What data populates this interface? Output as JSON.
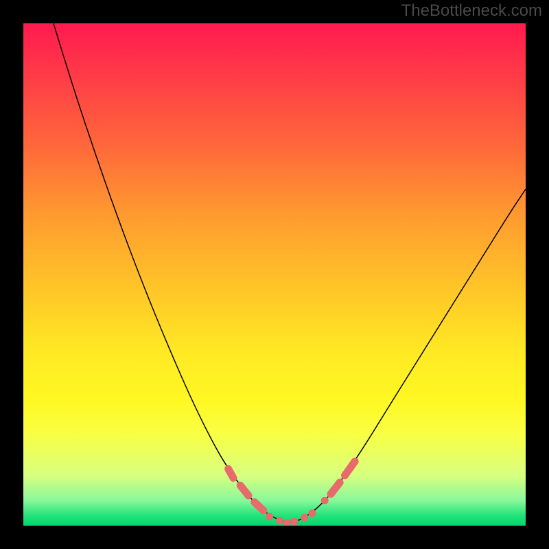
{
  "watermark": "TheBottleneck.com",
  "chart_data": {
    "type": "line",
    "title": "",
    "xlabel": "",
    "ylabel": "",
    "xlim": [
      0,
      1
    ],
    "ylim": [
      0,
      1
    ],
    "grid": false,
    "series": [
      {
        "name": "curve",
        "color": "#000000",
        "points": [
          {
            "x": 0.06,
            "y": 1.0
          },
          {
            "x": 0.1,
            "y": 0.87
          },
          {
            "x": 0.15,
            "y": 0.72
          },
          {
            "x": 0.2,
            "y": 0.58
          },
          {
            "x": 0.25,
            "y": 0.45
          },
          {
            "x": 0.3,
            "y": 0.33
          },
          {
            "x": 0.34,
            "y": 0.24
          },
          {
            "x": 0.38,
            "y": 0.16
          },
          {
            "x": 0.41,
            "y": 0.11
          },
          {
            "x": 0.44,
            "y": 0.07
          },
          {
            "x": 0.47,
            "y": 0.035
          },
          {
            "x": 0.5,
            "y": 0.015
          },
          {
            "x": 0.525,
            "y": 0.006
          },
          {
            "x": 0.55,
            "y": 0.01
          },
          {
            "x": 0.58,
            "y": 0.03
          },
          {
            "x": 0.61,
            "y": 0.06
          },
          {
            "x": 0.64,
            "y": 0.1
          },
          {
            "x": 0.68,
            "y": 0.16
          },
          {
            "x": 0.72,
            "y": 0.225
          },
          {
            "x": 0.77,
            "y": 0.305
          },
          {
            "x": 0.82,
            "y": 0.385
          },
          {
            "x": 0.87,
            "y": 0.465
          },
          {
            "x": 0.92,
            "y": 0.545
          },
          {
            "x": 0.97,
            "y": 0.625
          },
          {
            "x": 1.0,
            "y": 0.67
          }
        ]
      }
    ],
    "markers": {
      "color": "#e86a6a",
      "dot_radius": 5.5,
      "segments": [
        {
          "from": {
            "x": 0.408,
            "y": 0.113
          },
          "to": {
            "x": 0.418,
            "y": 0.095
          }
        },
        {
          "from": {
            "x": 0.432,
            "y": 0.08
          },
          "to": {
            "x": 0.448,
            "y": 0.06
          }
        },
        {
          "from": {
            "x": 0.46,
            "y": 0.047
          },
          "to": {
            "x": 0.478,
            "y": 0.03
          }
        },
        {
          "from": {
            "x": 0.612,
            "y": 0.063
          },
          "to": {
            "x": 0.63,
            "y": 0.086
          }
        },
        {
          "from": {
            "x": 0.64,
            "y": 0.1
          },
          "to": {
            "x": 0.66,
            "y": 0.128
          }
        }
      ],
      "dots": [
        {
          "x": 0.49,
          "y": 0.018
        },
        {
          "x": 0.51,
          "y": 0.01
        },
        {
          "x": 0.525,
          "y": 0.006
        },
        {
          "x": 0.54,
          "y": 0.008
        },
        {
          "x": 0.56,
          "y": 0.016
        },
        {
          "x": 0.575,
          "y": 0.025
        },
        {
          "x": 0.6,
          "y": 0.05
        }
      ]
    },
    "background_gradient": {
      "top": "#ff1a4f",
      "middle": "#ffe824",
      "bottom": "#00d86f"
    }
  }
}
